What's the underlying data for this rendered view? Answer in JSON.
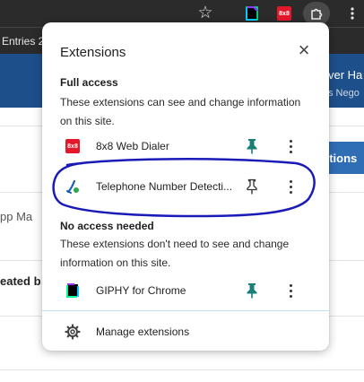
{
  "browser": {
    "bookmark_text": "Entries 2",
    "icons": {
      "star": "star-icon",
      "giphy": "giphy-icon",
      "dialer": "8x8-icon",
      "extensions": "puzzle-icon",
      "menu": "kebab-icon"
    }
  },
  "background_page": {
    "header_right_title": "ver Ha",
    "header_right_sub": "s Nego",
    "action_button": "ctions",
    "left_text_1": "pp Ma",
    "left_text_2": "eated b"
  },
  "popup": {
    "title": "Extensions",
    "close_label": "×",
    "full_access": {
      "heading": "Full access",
      "description": "These extensions can see and change information on this site.",
      "items": [
        {
          "name": "8x8 Web Dialer",
          "icon": "8x8-icon",
          "icon_text": "8x8",
          "pinned": true
        },
        {
          "name": "Telephone Number Detecti...",
          "icon": "phone-detect-icon",
          "pinned": false
        }
      ]
    },
    "no_access": {
      "heading": "No access needed",
      "description": "These extensions don't need to see and change information on this site.",
      "items": [
        {
          "name": "GIPHY for Chrome",
          "icon": "giphy-icon",
          "pinned": true
        }
      ]
    },
    "manage_label": "Manage extensions"
  },
  "colors": {
    "pin_active": "#1a7f79",
    "annotation": "#1a1ab8",
    "badge_red": "#e4172b",
    "page_blue": "#1d4f8b"
  }
}
